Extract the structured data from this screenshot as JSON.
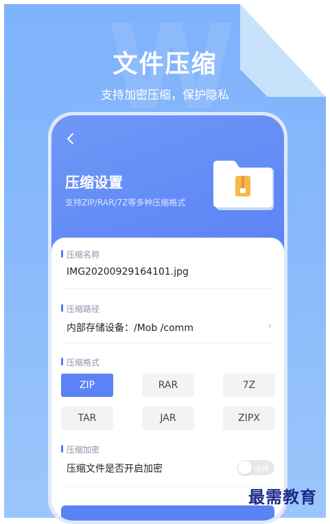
{
  "hero": {
    "title": "文件压缩",
    "subtitle": "支持加密压缩，保护隐私"
  },
  "header": {
    "title": "压缩设置",
    "subtitle": "支持ZIP/RAR/7Z等多种压缩格式"
  },
  "form": {
    "name_label": "压缩名称",
    "name_value": "IMG20200929164101.jpg",
    "path_label": "压缩路径",
    "path_value": "内部存储设备：/Mob /comm",
    "format_label": "压缩格式",
    "formats": [
      "ZIP",
      "RAR",
      "7Z",
      "TAR",
      "JAR",
      "ZIPX"
    ],
    "selected_format": "ZIP",
    "encrypt_label": "压缩加密",
    "encrypt_question": "压缩文件是否开启加密",
    "encrypt_toggle_text": "关闭"
  },
  "watermark": "最需教育",
  "colors": {
    "accent": "#5b83f5",
    "background": "#86b8fb"
  }
}
